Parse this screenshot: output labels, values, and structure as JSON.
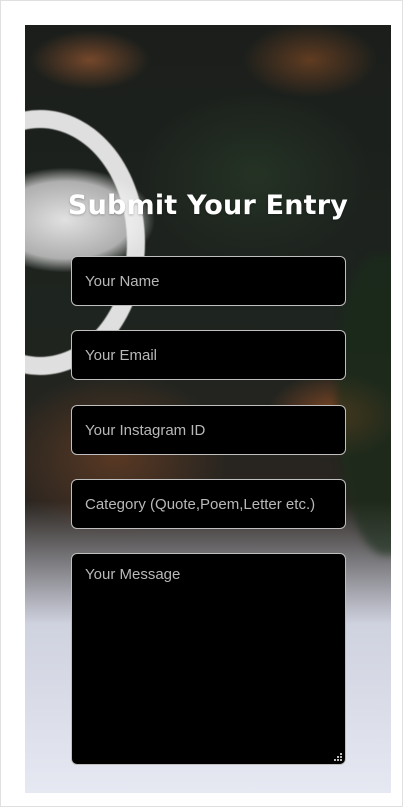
{
  "form": {
    "title": "Submit Your Entry",
    "fields": [
      {
        "placeholder": "Your Name",
        "value": ""
      },
      {
        "placeholder": "Your Email",
        "value": ""
      },
      {
        "placeholder": "Your Instagram ID",
        "value": ""
      },
      {
        "placeholder": "Category (Quote,Poem,Letter etc.)",
        "value": ""
      }
    ],
    "message": {
      "placeholder": "Your Message",
      "value": ""
    }
  },
  "colors": {
    "field_background": "#000000",
    "field_border": "#ffffff",
    "title_color": "#ffffff"
  },
  "icons": {
    "resize_grip": "resize-grip-icon"
  }
}
